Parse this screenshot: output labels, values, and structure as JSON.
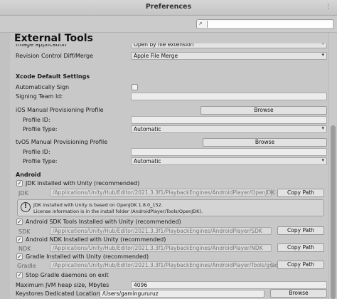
{
  "window": {
    "title": "Preferences",
    "menu": "⋮"
  },
  "search": {
    "icon": "search-icon",
    "value": ""
  },
  "section_title": "External Tools",
  "image_application": {
    "label": "Image application",
    "value": "Open by file extension"
  },
  "revision_control": {
    "label": "Revision Control Diff/Merge",
    "value": "Apple File Merge"
  },
  "xcode": {
    "heading": "Xcode Default Settings",
    "auto_sign_label": "Automatically Sign",
    "auto_sign_checked": false,
    "signing_team_label": "Signing Team Id:",
    "signing_team_value": "",
    "ios_profile_label": "iOS Manual Provisioning Profile",
    "ios_browse": "Browse",
    "ios_profile_id_label": "Profile ID:",
    "ios_profile_id_value": "",
    "ios_profile_type_label": "Profile Type:",
    "ios_profile_type_value": "Automatic",
    "tvos_profile_label": "tvOS Manual Provisioning Profile",
    "tvos_browse": "Browse",
    "tvos_profile_id_label": "Profile ID:",
    "tvos_profile_id_value": "",
    "tvos_profile_type_label": "Profile Type:",
    "tvos_profile_type_value": "Automatic"
  },
  "android": {
    "heading": "Android",
    "jdk_check_label": "JDK Installed with Unity (recommended)",
    "jdk_checked": true,
    "jdk_label": "JDK",
    "jdk_path": "/Applications/Unity/Hub/Editor/2021.3.3f1/PlaybackEngines/AndroidPlayer/OpenJDK",
    "jdk_copy": "Copy Path",
    "info_icon": "info-icon",
    "info_line1": "JDK installed with Unity is based on OpenJDK 1.8.0_152.",
    "info_line2": "License information is in the install folder (AndroidPlayer/Tools/OpenJDK).",
    "sdk_check_label": "Android SDK Tools Installed with Unity (recommended)",
    "sdk_checked": true,
    "sdk_label": "SDK",
    "sdk_path": "/Applications/Unity/Hub/Editor/2021.3.3f1/PlaybackEngines/AndroidPlayer/SDK",
    "sdk_copy": "Copy Path",
    "ndk_check_label": "Android NDK Installed with Unity (recommended)",
    "ndk_checked": true,
    "ndk_label": "NDK",
    "ndk_path": "/Applications/Unity/Hub/Editor/2021.3.3f1/PlaybackEngines/AndroidPlayer/NDK",
    "ndk_copy": "Copy Path",
    "gradle_check_label": "Gradle Installed with Unity (recommended)",
    "gradle_checked": true,
    "gradle_label": "Gradle",
    "gradle_path": "/Applications/Unity/Hub/Editor/2021.3.3f1/PlaybackEngines/AndroidPlayer/Tools/gradle",
    "gradle_copy": "Copy Path",
    "stop_daemons_label": "Stop Gradle daemons on exit",
    "stop_daemons_checked": true,
    "jvm_heap_label": "Maximum JVM heap size, Mbytes",
    "jvm_heap_value": "4096",
    "keystores_label": "Keystores Dedicated Location",
    "keystores_value": "/Users/gamingururuz",
    "keystores_browse": "Browse"
  }
}
